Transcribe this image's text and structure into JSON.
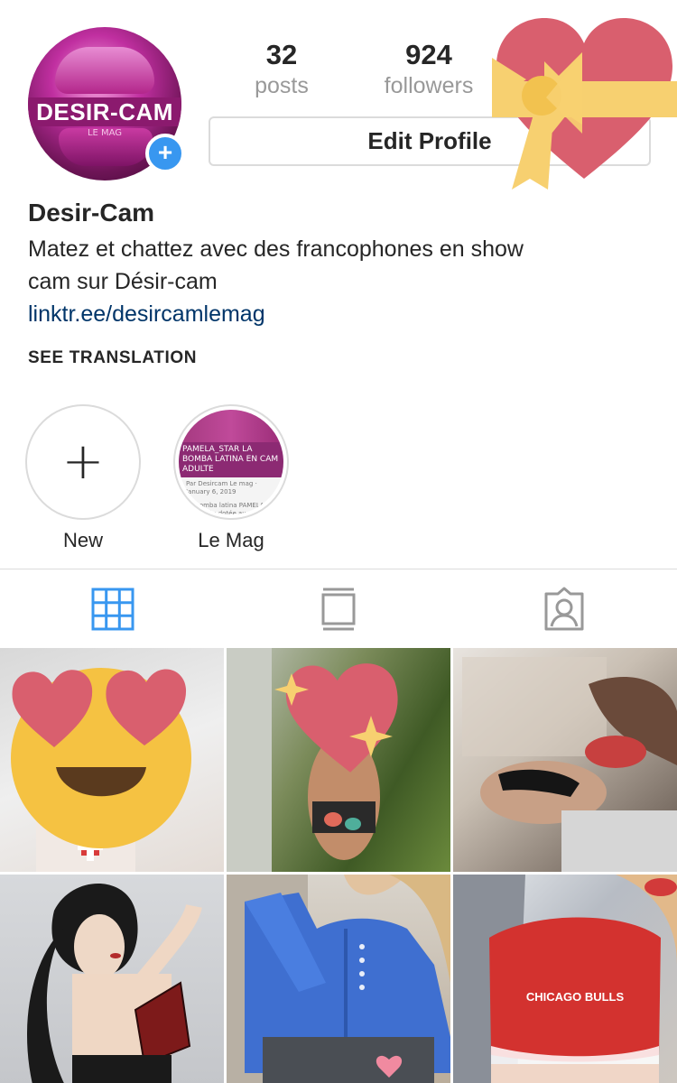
{
  "profile": {
    "avatar_brand": "DESIR-CAM",
    "avatar_sub": "LE MAG",
    "name": "Desir-Cam",
    "bio_line1": "Matez et chattez avec des francophones en show",
    "bio_line2": "cam sur Désir-cam",
    "link": "linktr.ee/desircamlemag",
    "see_translation": "SEE TRANSLATION"
  },
  "stats": {
    "posts_count": "32",
    "posts_label": "posts",
    "followers_count": "924",
    "followers_label": "followers"
  },
  "actions": {
    "edit_profile": "Edit Profile"
  },
  "highlights": [
    {
      "label": "New",
      "icon": "plus-icon"
    },
    {
      "label": "Le Mag",
      "thumb_title": "PAMELA_STAR LA BOMBA LATINA EN CAM ADULTE",
      "thumb_meta": "Par Desircam Le mag · January 6, 2019",
      "thumb_text": "La bomba latina PAMELA-STAR très dotée au gros postérieur nous a ... une interview très ép..."
    }
  ],
  "tabs": [
    {
      "icon": "grid-icon",
      "active": true
    },
    {
      "icon": "feed-icon",
      "active": false
    },
    {
      "icon": "tagged-icon",
      "active": false
    }
  ],
  "grid": {
    "cell3_caption": "CHICAGO BULLS"
  },
  "colors": {
    "accent": "#3897f0",
    "link": "#003569",
    "heart": "#d95f6e",
    "bow": "#f7d070",
    "emoji_face": "#f5c242",
    "muted": "#999999",
    "border": "#dbdbdb"
  }
}
